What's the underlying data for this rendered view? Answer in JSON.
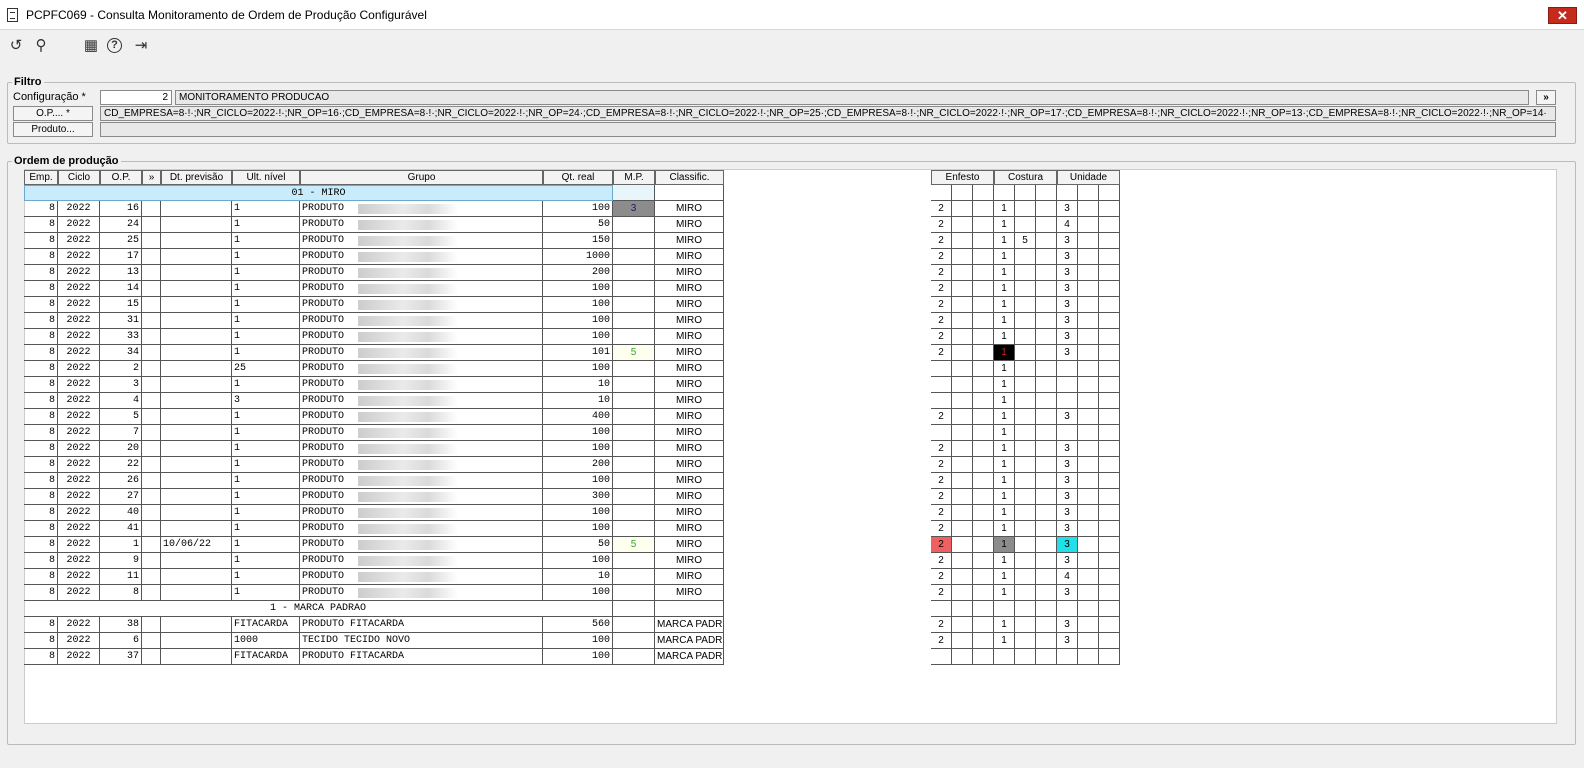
{
  "window": {
    "title": "PCPFC069 - Consulta Monitoramento de Ordem de Produção Configurável",
    "close": "✕"
  },
  "toolbar": {
    "undo": "↺",
    "search": "⚲",
    "calendar": "▦",
    "help": "?",
    "exit": "⇥"
  },
  "filtro": {
    "legend": "Filtro",
    "config_label": "Configuração *",
    "config_value": "2",
    "config_desc": "MONITORAMENTO PRODUCAO",
    "op_button": "O.P.... *",
    "op_value": "CD_EMPRESA=8·!·;NR_CICLO=2022·!·;NR_OP=16·;CD_EMPRESA=8·!·;NR_CICLO=2022·!·;NR_OP=24·;CD_EMPRESA=8·!·;NR_CICLO=2022·!·;NR_OP=25·;CD_EMPRESA=8·!·;NR_CICLO=2022·!·;NR_OP=17·;CD_EMPRESA=8·!·;NR_CICLO=2022·!·;NR_OP=13·;CD_EMPRESA=8·!·;NR_CICLO=2022·!·;NR_OP=14·",
    "produto_button": "Produto...",
    "produto_value": "",
    "more": "»"
  },
  "ordem": {
    "legend": "Ordem de produção",
    "headers": [
      "Emp.",
      "Ciclo",
      "O.P.",
      "»",
      "Dt. previsão",
      "Ult. nível",
      "Grupo",
      "Qt. real",
      "M.P.",
      "Classific."
    ],
    "right_headers": [
      "Enfesto",
      "Costura",
      "Unidade"
    ],
    "groups": [
      {
        "label": "01 - MIRO",
        "rows": [
          {
            "emp": "8",
            "ciclo": "2022",
            "op": "16",
            "dt": "",
            "ult": "1",
            "grupo": "PRODUTO",
            "qt": "100",
            "mp": "3",
            "mpc": "#8c8c8c",
            "mpt": "#1a1a66",
            "cls": "MIRO",
            "enf": "2",
            "cos": "1",
            "cos2": "",
            "uni": "3",
            "enfc": "",
            "cosc": "",
            "unic": ""
          },
          {
            "emp": "8",
            "ciclo": "2022",
            "op": "24",
            "dt": "",
            "ult": "1",
            "grupo": "PRODUTO",
            "qt": "50",
            "mp": "",
            "cls": "MIRO",
            "enf": "2",
            "cos": "1",
            "cos2": "",
            "uni": "4"
          },
          {
            "emp": "8",
            "ciclo": "2022",
            "op": "25",
            "dt": "",
            "ult": "1",
            "grupo": "PRODUTO",
            "qt": "150",
            "mp": "",
            "cls": "MIRO",
            "enf": "2",
            "cos": "1",
            "cos2": "5",
            "uni": "3"
          },
          {
            "emp": "8",
            "ciclo": "2022",
            "op": "17",
            "dt": "",
            "ult": "1",
            "grupo": "PRODUTO",
            "qt": "1000",
            "mp": "",
            "cls": "MIRO",
            "enf": "2",
            "cos": "1",
            "cos2": "",
            "uni": "3"
          },
          {
            "emp": "8",
            "ciclo": "2022",
            "op": "13",
            "dt": "",
            "ult": "1",
            "grupo": "PRODUTO",
            "qt": "200",
            "mp": "",
            "cls": "MIRO",
            "enf": "2",
            "cos": "1",
            "cos2": "",
            "uni": "3"
          },
          {
            "emp": "8",
            "ciclo": "2022",
            "op": "14",
            "dt": "",
            "ult": "1",
            "grupo": "PRODUTO",
            "qt": "100",
            "mp": "",
            "cls": "MIRO",
            "enf": "2",
            "cos": "1",
            "cos2": "",
            "uni": "3"
          },
          {
            "emp": "8",
            "ciclo": "2022",
            "op": "15",
            "dt": "",
            "ult": "1",
            "grupo": "PRODUTO",
            "qt": "100",
            "mp": "",
            "cls": "MIRO",
            "enf": "2",
            "cos": "1",
            "cos2": "",
            "uni": "3"
          },
          {
            "emp": "8",
            "ciclo": "2022",
            "op": "31",
            "dt": "",
            "ult": "1",
            "grupo": "PRODUTO",
            "qt": "100",
            "mp": "",
            "cls": "MIRO",
            "enf": "2",
            "cos": "1",
            "cos2": "",
            "uni": "3"
          },
          {
            "emp": "8",
            "ciclo": "2022",
            "op": "33",
            "dt": "",
            "ult": "1",
            "grupo": "PRODUTO",
            "qt": "100",
            "mp": "",
            "cls": "MIRO",
            "enf": "2",
            "cos": "1",
            "cos2": "",
            "uni": "3"
          },
          {
            "emp": "8",
            "ciclo": "2022",
            "op": "34",
            "dt": "",
            "ult": "1",
            "grupo": "PRODUTO",
            "qt": "101",
            "mp": "5",
            "mpc": "#fffff0",
            "mpt": "#3aa02a",
            "cls": "MIRO",
            "enf": "2",
            "cos": "1",
            "cos2": "",
            "uni": "3",
            "cosc": "#000000",
            "cost": "#d02020"
          },
          {
            "emp": "8",
            "ciclo": "2022",
            "op": "2",
            "dt": "",
            "ult": "25",
            "grupo": "PRODUTO",
            "qt": "100",
            "mp": "",
            "cls": "MIRO",
            "enf": "",
            "cos": "1",
            "cos2": "",
            "uni": ""
          },
          {
            "emp": "8",
            "ciclo": "2022",
            "op": "3",
            "dt": "",
            "ult": "1",
            "grupo": "PRODUTO",
            "qt": "10",
            "mp": "",
            "cls": "MIRO",
            "enf": "",
            "cos": "1",
            "cos2": "",
            "uni": ""
          },
          {
            "emp": "8",
            "ciclo": "2022",
            "op": "4",
            "dt": "",
            "ult": "3",
            "grupo": "PRODUTO",
            "qt": "10",
            "mp": "",
            "cls": "MIRO",
            "enf": "",
            "cos": "1",
            "cos2": "",
            "uni": ""
          },
          {
            "emp": "8",
            "ciclo": "2022",
            "op": "5",
            "dt": "",
            "ult": "1",
            "grupo": "PRODUTO",
            "qt": "400",
            "mp": "",
            "cls": "MIRO",
            "enf": "2",
            "cos": "1",
            "cos2": "",
            "uni": "3"
          },
          {
            "emp": "8",
            "ciclo": "2022",
            "op": "7",
            "dt": "",
            "ult": "1",
            "grupo": "PRODUTO",
            "qt": "100",
            "mp": "",
            "cls": "MIRO",
            "enf": "",
            "cos": "1",
            "cos2": "",
            "uni": ""
          },
          {
            "emp": "8",
            "ciclo": "2022",
            "op": "20",
            "dt": "",
            "ult": "1",
            "grupo": "PRODUTO",
            "qt": "100",
            "mp": "",
            "cls": "MIRO",
            "enf": "2",
            "cos": "1",
            "cos2": "",
            "uni": "3"
          },
          {
            "emp": "8",
            "ciclo": "2022",
            "op": "22",
            "dt": "",
            "ult": "1",
            "grupo": "PRODUTO",
            "qt": "200",
            "mp": "",
            "cls": "MIRO",
            "enf": "2",
            "cos": "1",
            "cos2": "",
            "uni": "3"
          },
          {
            "emp": "8",
            "ciclo": "2022",
            "op": "26",
            "dt": "",
            "ult": "1",
            "grupo": "PRODUTO",
            "qt": "100",
            "mp": "",
            "cls": "MIRO",
            "enf": "2",
            "cos": "1",
            "cos2": "",
            "uni": "3"
          },
          {
            "emp": "8",
            "ciclo": "2022",
            "op": "27",
            "dt": "",
            "ult": "1",
            "grupo": "PRODUTO",
            "qt": "300",
            "mp": "",
            "cls": "MIRO",
            "enf": "2",
            "cos": "1",
            "cos2": "",
            "uni": "3"
          },
          {
            "emp": "8",
            "ciclo": "2022",
            "op": "40",
            "dt": "",
            "ult": "1",
            "grupo": "PRODUTO",
            "qt": "100",
            "mp": "",
            "cls": "MIRO",
            "enf": "2",
            "cos": "1",
            "cos2": "",
            "uni": "3"
          },
          {
            "emp": "8",
            "ciclo": "2022",
            "op": "41",
            "dt": "",
            "ult": "1",
            "grupo": "PRODUTO",
            "qt": "100",
            "mp": "",
            "cls": "MIRO",
            "enf": "2",
            "cos": "1",
            "cos2": "",
            "uni": "3"
          },
          {
            "emp": "8",
            "ciclo": "2022",
            "op": "1",
            "dt": "10/06/22",
            "ult": "1",
            "grupo": "PRODUTO",
            "qt": "50",
            "mp": "5",
            "mpc": "#fffff0",
            "mpt": "#3aa02a",
            "cls": "MIRO",
            "enf": "2",
            "cos": "1",
            "cos2": "",
            "uni": "3",
            "enfc": "#f06060",
            "cosc": "#8c8c8c",
            "unic": "#20e0e8"
          },
          {
            "emp": "8",
            "ciclo": "2022",
            "op": "9",
            "dt": "",
            "ult": "1",
            "grupo": "PRODUTO",
            "qt": "100",
            "mp": "",
            "cls": "MIRO",
            "enf": "2",
            "cos": "1",
            "cos2": "",
            "uni": "3"
          },
          {
            "emp": "8",
            "ciclo": "2022",
            "op": "11",
            "dt": "",
            "ult": "1",
            "grupo": "PRODUTO",
            "qt": "10",
            "mp": "",
            "cls": "MIRO",
            "enf": "2",
            "cos": "1",
            "cos2": "",
            "uni": "4"
          },
          {
            "emp": "8",
            "ciclo": "2022",
            "op": "8",
            "dt": "",
            "ult": "1",
            "grupo": "PRODUTO",
            "qt": "100",
            "mp": "",
            "cls": "MIRO",
            "enf": "2",
            "cos": "1",
            "cos2": "",
            "uni": "3"
          }
        ]
      },
      {
        "label": "1 - MARCA PADRAO",
        "rows": [
          {
            "emp": "8",
            "ciclo": "2022",
            "op": "38",
            "dt": "",
            "ult": "FITACARDA",
            "grupo": "PRODUTO FITACARDA",
            "qt": "560",
            "mp": "",
            "cls": "MARCA PADR",
            "enf": "2",
            "cos": "1",
            "cos2": "",
            "uni": "3",
            "noblur": true
          },
          {
            "emp": "8",
            "ciclo": "2022",
            "op": "6",
            "dt": "",
            "ult": "1000",
            "grupo": "TECIDO TECIDO NOVO",
            "qt": "100",
            "mp": "",
            "cls": "MARCA PADR",
            "enf": "2",
            "cos": "1",
            "cos2": "",
            "uni": "3",
            "noblur": true
          },
          {
            "emp": "8",
            "ciclo": "2022",
            "op": "37",
            "dt": "",
            "ult": "FITACARDA",
            "grupo": "PRODUTO FITACARDA",
            "qt": "100",
            "mp": "",
            "cls": "MARCA PADR",
            "enf": "",
            "cos": "",
            "cos2": "",
            "uni": "",
            "noblur": true
          }
        ]
      }
    ]
  }
}
